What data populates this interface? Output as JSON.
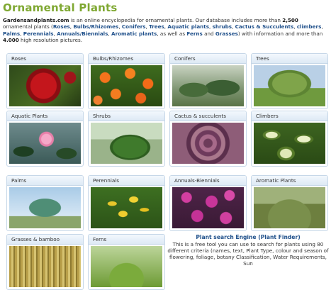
{
  "page": {
    "title": "Ornamental Plants",
    "intro": {
      "site": "Gardensandplants.com",
      "p1": " is an online encyclopedia for ornamental plants. Our database includes more than ",
      "count1": "2,500",
      "p2": " ornamental plants (",
      "links": [
        "Roses",
        "Bulbs/Rhizomes",
        "Conifers",
        "Trees",
        "Aquatic plants",
        "shrubs",
        "Cactus & Succulents",
        "climbers",
        "Palms",
        "Perennials",
        "Annuals/Biennials",
        "Aromatic plants",
        "Ferns",
        "Grasses"
      ],
      "p3": " with information and more than ",
      "count2": "4.000",
      "p4": " high resolution pictures."
    }
  },
  "categories": [
    {
      "label": "Roses",
      "image": "red-rose-photo"
    },
    {
      "label": "Bulbs/Rhizomes",
      "image": "orange-tulips-photo"
    },
    {
      "label": "Conifers",
      "image": "weeping-conifer-photo"
    },
    {
      "label": "Trees",
      "image": "weeping-willow-photo"
    },
    {
      "label": "Aquatic Plants",
      "image": "water-lily-photo"
    },
    {
      "label": "Shrubs",
      "image": "shrub-photo"
    },
    {
      "label": "Cactus & succulents",
      "image": "succulent-rosette-photo"
    },
    {
      "label": "Climbers",
      "image": "ivy-leaves-photo"
    },
    {
      "label": "Palms",
      "image": "palm-tree-photo"
    },
    {
      "label": "Perennials",
      "image": "yellow-perennial-photo"
    },
    {
      "label": "Annuals-Biennials",
      "image": "pink-annuals-photo"
    },
    {
      "label": "Aromatic Plants",
      "image": "aromatic-shrub-photo"
    },
    {
      "label": "Grasses & bamboo",
      "image": "bamboo-photo"
    },
    {
      "label": "Ferns",
      "image": "fern-photo"
    }
  ],
  "finder": {
    "title": "Plant search Engine (Plant Finder)",
    "text": "This is a free tool you can use to search for plants using 80 different criteria (names, text, Plant Type, colour and season of flowering, foliage, botany Classification, Water Requirements, Sun"
  }
}
